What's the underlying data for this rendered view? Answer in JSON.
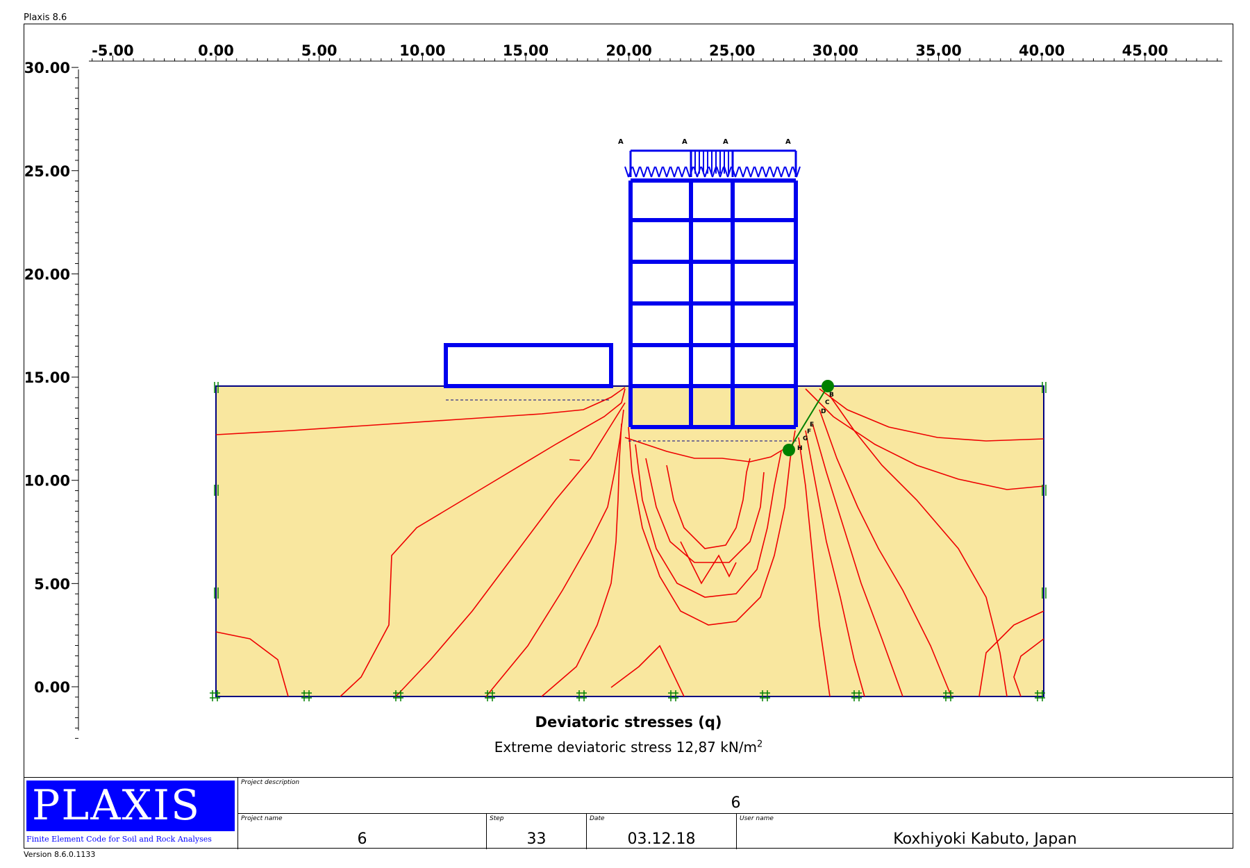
{
  "window": {
    "app_title": "Plaxis 8.6",
    "version": "Version 8.6.0.1133"
  },
  "plot": {
    "x_ticks": [
      "-5.00",
      "0.00",
      "5.00",
      "10.00",
      "15.00",
      "20.00",
      "25.00",
      "30.00",
      "35.00",
      "40.00",
      "45.00"
    ],
    "y_ticks": [
      "30.00",
      "25.00",
      "20.00",
      "15.00",
      "10.00",
      "5.00",
      "0.00"
    ],
    "title": "Deviatoric stresses (q)",
    "subtitle_text": "Extreme deviatoric stress 12,87 kN/m",
    "subtitle_exponent": "2",
    "load_labels": [
      "A",
      "A",
      "A",
      "A"
    ],
    "anchor_labels": [
      "B",
      "C",
      "D",
      "E",
      "F",
      "G",
      "H"
    ],
    "colors": {
      "soil": "#f9e79f",
      "structure": "#0000ee",
      "contour": "#ee0000",
      "anchor": "#008000",
      "boundary": "#000080"
    }
  },
  "footer": {
    "logo_text": "PLAXIS",
    "logo_subtitle": "Finite Element Code for Soil and Rock Analyses",
    "description_label": "Project description",
    "description_value": "6",
    "name_label": "Project name",
    "name_value": "6",
    "step_label": "Step",
    "step_value": "33",
    "date_label": "Date",
    "date_value": "03.12.18",
    "user_label": "User name",
    "user_value": "Koxhiyoki Kabuto, Japan"
  }
}
